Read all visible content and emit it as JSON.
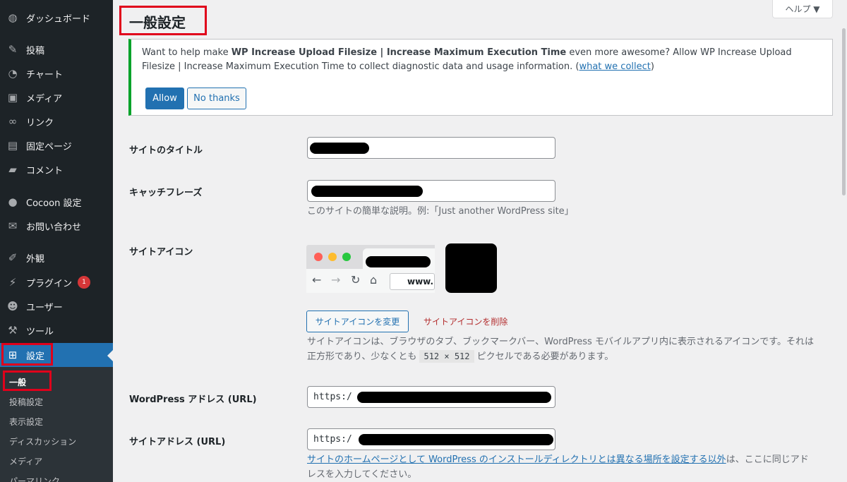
{
  "sidebar": {
    "items": [
      {
        "label": "ダッシュボード",
        "icon": "dashboard-icon"
      },
      {
        "label": "投稿",
        "icon": "pin-icon"
      },
      {
        "label": "チャート",
        "icon": "pie-chart-icon"
      },
      {
        "label": "メディア",
        "icon": "media-icon"
      },
      {
        "label": "リンク",
        "icon": "link-icon"
      },
      {
        "label": "固定ページ",
        "icon": "page-icon"
      },
      {
        "label": "コメント",
        "icon": "comment-icon"
      },
      {
        "label": "Cocoon 設定",
        "icon": "cocoon-icon"
      },
      {
        "label": "お問い合わせ",
        "icon": "mail-icon"
      },
      {
        "label": "外観",
        "icon": "brush-icon"
      },
      {
        "label": "プラグイン",
        "icon": "plugin-icon",
        "badge": "1"
      },
      {
        "label": "ユーザー",
        "icon": "user-icon"
      },
      {
        "label": "ツール",
        "icon": "wrench-icon"
      },
      {
        "label": "設定",
        "icon": "settings-icon",
        "active": true
      }
    ],
    "submenu": [
      "一般",
      "投稿設定",
      "表示設定",
      "ディスカッション",
      "メディア",
      "パーマリンク"
    ]
  },
  "header": {
    "help_label": "ヘルプ ▼",
    "page_title": "一般設定"
  },
  "notice": {
    "text_before": "Want to help make ",
    "plugin_name": "WP Increase Upload Filesize | Increase Maximum Execution Time",
    "text_after": " even more awesome? Allow WP Increase Upload Filesize | Increase Maximum Execution Time to collect diagnostic data and usage information. (",
    "link_label": "what we collect",
    "text_end": ")",
    "allow_label": "Allow",
    "no_thanks_label": "No thanks"
  },
  "form": {
    "site_title_label": "サイトのタイトル",
    "tagline_label": "キャッチフレーズ",
    "tagline_desc": "このサイトの簡単な説明。例:「Just another WordPress site」",
    "site_icon_label": "サイトアイコン",
    "preview_url": "www.",
    "change_icon_label": "サイトアイコンを変更",
    "remove_icon_label": "サイトアイコンを削除",
    "icon_desc_1": "サイトアイコンは、ブラウザのタブ、ブックマークバー、WordPress モバイルアプリ内に表示されるアイコンです。それは",
    "icon_desc_2a": "正方形であり、少なくとも ",
    "icon_desc_code": "512 × 512",
    "icon_desc_2b": " ピクセルである必要があります。",
    "wp_address_label": "WordPress アドレス (URL)",
    "wp_address_value": "https:/",
    "site_address_label": "サイトアドレス (URL)",
    "site_address_value": "https:/",
    "site_address_link": "サイトのホームページとして WordPress のインストールディレクトリとは異なる場所を設定する以外",
    "site_address_desc_1": "は、ここに同じアド",
    "site_address_desc_2": "レスを入力してください。"
  },
  "colors": {
    "sidebar_bg": "#1d2327",
    "accent": "#2271b1",
    "highlight_box": "#e0001b",
    "notice_border": "#00a32a"
  }
}
